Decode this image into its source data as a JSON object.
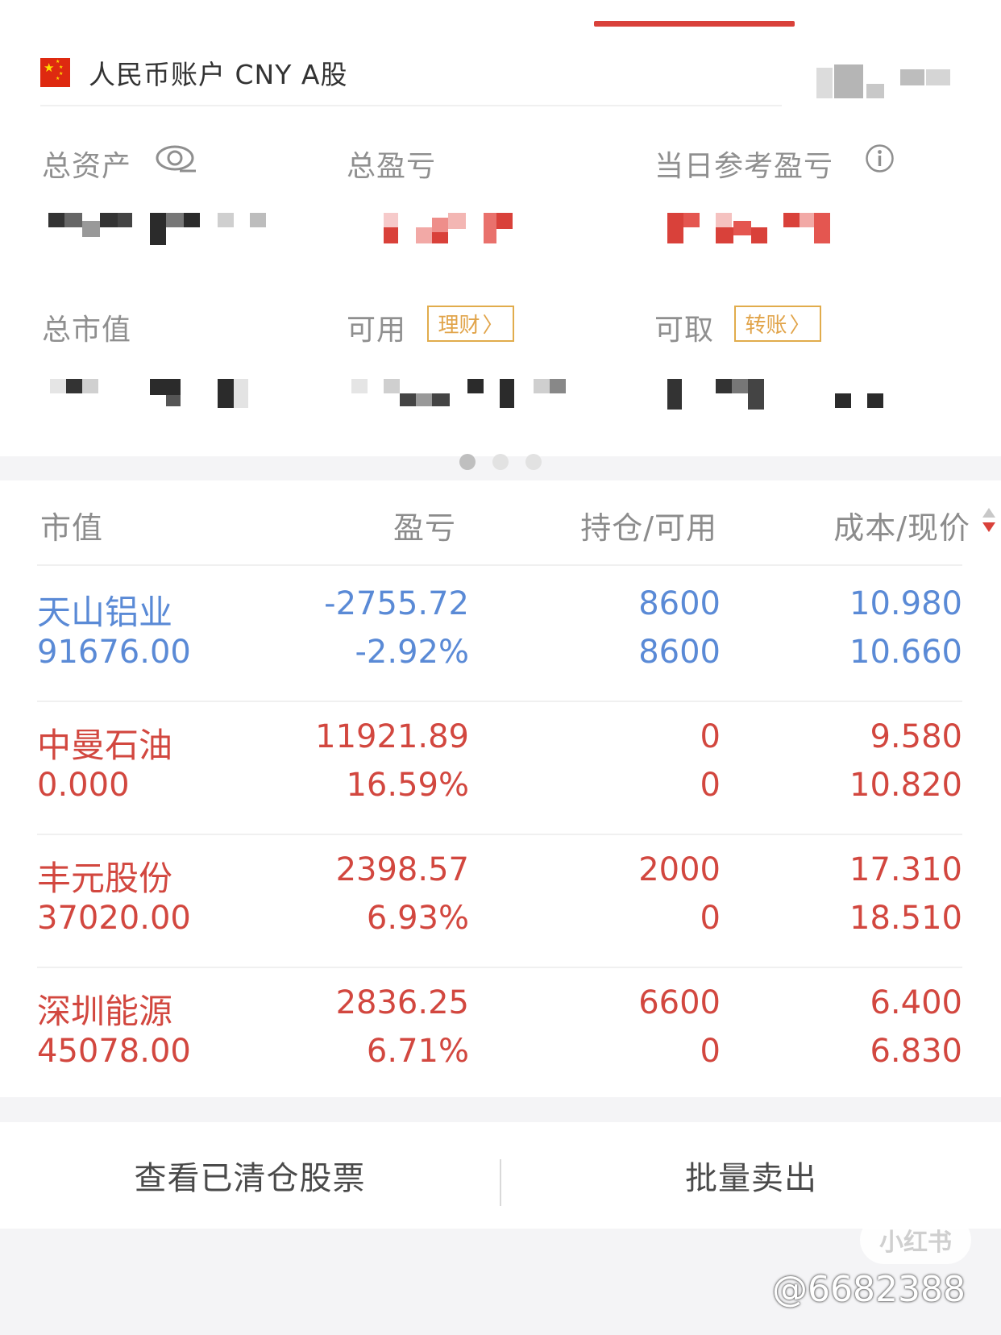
{
  "colors": {
    "accent": "#d9413a",
    "loss": "#5a8ad6",
    "gain": "#d2473f",
    "tag": "#e1a44a"
  },
  "account": {
    "flag_icon": "china-flag-icon",
    "title": "人民币账户 CNY A股"
  },
  "summary": {
    "total_assets_label": "总资产",
    "total_pnl_label": "总盈亏",
    "daily_pnl_label": "当日参考盈亏",
    "market_value_label": "总市值",
    "available_label": "可用",
    "withdrawable_label": "可取",
    "wealth_button": "理财",
    "transfer_button": "转账",
    "eye_icon": "eye-icon",
    "info_icon": "info-icon"
  },
  "table": {
    "headers": [
      "市值",
      "盈亏",
      "持仓/可用",
      "成本/现价"
    ],
    "rows": [
      {
        "name": "天山铝业",
        "market_value": "91676.00",
        "pnl": "-2755.72",
        "pnl_pct": "-2.92%",
        "position": "8600",
        "available": "8600",
        "cost": "10.980",
        "price": "10.660",
        "trend": "loss"
      },
      {
        "name": "中曼石油",
        "market_value": "0.000",
        "pnl": "11921.89",
        "pnl_pct": "16.59%",
        "position": "0",
        "available": "0",
        "cost": "9.580",
        "price": "10.820",
        "trend": "gain"
      },
      {
        "name": "丰元股份",
        "market_value": "37020.00",
        "pnl": "2398.57",
        "pnl_pct": "6.93%",
        "position": "2000",
        "available": "0",
        "cost": "17.310",
        "price": "18.510",
        "trend": "gain"
      },
      {
        "name": "深圳能源",
        "market_value": "45078.00",
        "pnl": "2836.25",
        "pnl_pct": "6.71%",
        "position": "6600",
        "available": "0",
        "cost": "6.400",
        "price": "6.830",
        "trend": "gain"
      }
    ]
  },
  "footer": {
    "view_cleared": "查看已清仓股票",
    "batch_sell": "批量卖出"
  },
  "watermark": {
    "badge": "小红书",
    "id": "@6682388"
  }
}
